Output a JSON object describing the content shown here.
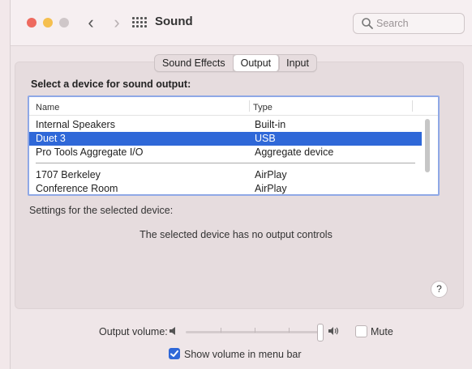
{
  "window": {
    "title": "Sound"
  },
  "search": {
    "placeholder": "Search"
  },
  "tabs": [
    {
      "label": "Sound Effects",
      "active": false
    },
    {
      "label": "Output",
      "active": true
    },
    {
      "label": "Input",
      "active": false
    }
  ],
  "output": {
    "heading": "Select a device for sound output:",
    "columns": {
      "name": "Name",
      "type": "Type"
    },
    "devices": [
      {
        "name": "Internal Speakers",
        "type": "Built-in",
        "selected": false
      },
      {
        "name": "Duet 3",
        "type": "USB",
        "selected": true
      },
      {
        "name": "Pro Tools Aggregate I/O",
        "type": "Aggregate device",
        "selected": false
      },
      {
        "name": "1707 Berkeley",
        "type": "AirPlay",
        "selected": false
      },
      {
        "name": "Conference Room",
        "type": "AirPlay",
        "selected": false
      }
    ],
    "settings_label": "Settings for the selected device:",
    "no_controls": "The selected device has no output controls",
    "help": "?"
  },
  "volume": {
    "label": "Output volume:",
    "level": 1.0,
    "mute_label": "Mute",
    "muted": false,
    "menu_bar_label": "Show volume in menu bar",
    "show_in_menu_bar": true
  },
  "colors": {
    "selection": "#2f68d8",
    "close": "#ee6a5f",
    "minimize": "#f5bf4f",
    "focus_ring": "#8fa8e6"
  },
  "icons": {
    "back": "chevron-left-icon",
    "forward": "chevron-right-icon",
    "grid": "grid-icon",
    "search": "search-icon",
    "volume_low": "speaker-low-icon",
    "volume_high": "speaker-high-icon",
    "checkbox": "checkmark-icon"
  }
}
